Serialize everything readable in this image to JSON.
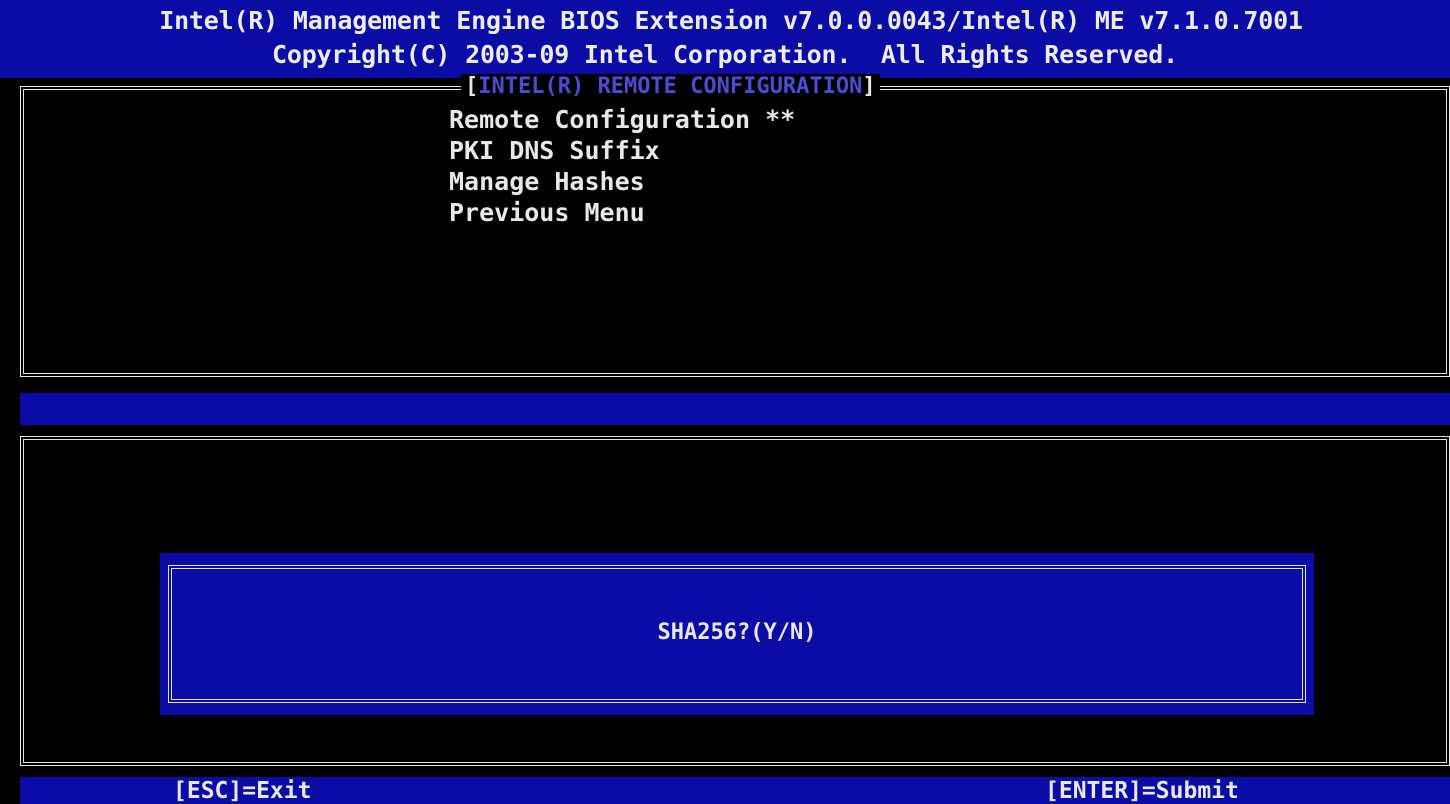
{
  "header": {
    "line1": "Intel(R) Management Engine BIOS Extension v7.0.0.0043/Intel(R) ME v7.1.0.7001",
    "line2": "Copyright(C) 2003-09 Intel Corporation.  All Rights Reserved."
  },
  "panel": {
    "title_open": "[",
    "title": "INTEL(R) REMOTE CONFIGURATION",
    "title_close": "]"
  },
  "menu": {
    "items": [
      {
        "label": "Remote Configuration **"
      },
      {
        "label": "PKI DNS Suffix"
      },
      {
        "label": "Manage Hashes"
      },
      {
        "label": "Previous Menu"
      }
    ]
  },
  "dialog": {
    "prompt": "SHA256?(Y/N)"
  },
  "footer": {
    "left": "[ESC]=Exit",
    "right": "[ENTER]=Submit"
  },
  "colors": {
    "background": "#000000",
    "bar_blue": "#0b0ba6",
    "title_blue": "#4b4bd8",
    "text": "#e8e8e8"
  }
}
